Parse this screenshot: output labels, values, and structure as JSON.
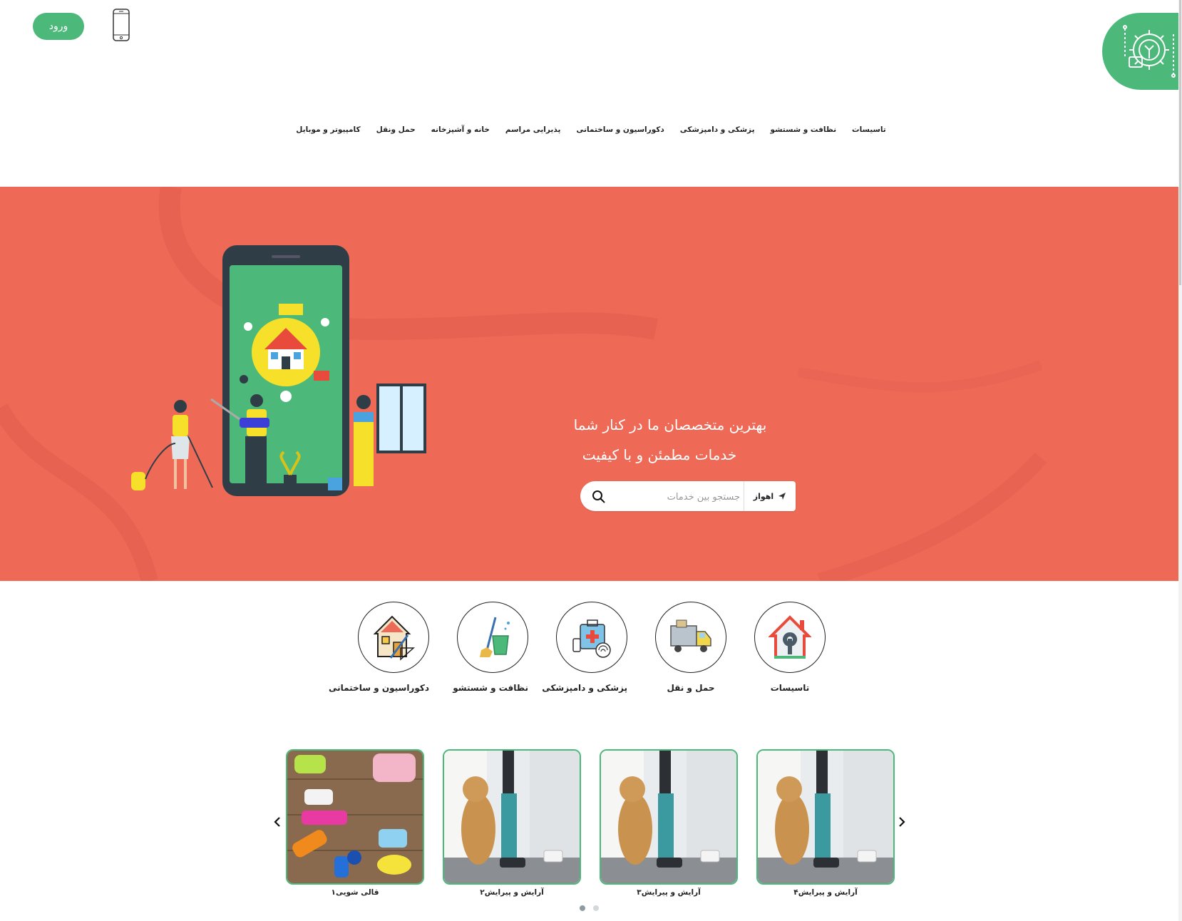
{
  "header": {
    "login_label": "ورود",
    "phone_icon": "mobile-phone-icon",
    "logo_icon": "gear-wrench-logo-icon",
    "brand_color": "#4cb97a"
  },
  "nav": {
    "items": [
      {
        "label": "تاسیسات"
      },
      {
        "label": "نظافت و شستشو"
      },
      {
        "label": "پزشکی و دامپزشکی"
      },
      {
        "label": "دکوراسیون و ساختمانی"
      },
      {
        "label": "پذیرایی مراسم"
      },
      {
        "label": "خانه و آشپزخانه"
      },
      {
        "label": "حمل ونقل"
      },
      {
        "label": "کامپیوتر و موبایل"
      }
    ]
  },
  "hero": {
    "background_color": "#ee6a57",
    "headline": "بهترین متخصصان ما در کنار شما",
    "subheadline": "خدمات مطمئن و با کیفیت",
    "city_label": "اهواز",
    "search_placeholder": "جستجو بین خدمات"
  },
  "categories": [
    {
      "label": "تاسیسات",
      "icon": "house-wrench-icon"
    },
    {
      "label": "حمل و نقل",
      "icon": "delivery-truck-icon"
    },
    {
      "label": "پزشکی و دامپزشکی",
      "icon": "medical-kit-icon"
    },
    {
      "label": "نظافت و شستشو",
      "icon": "mop-bucket-icon"
    },
    {
      "label": "دکوراسیون و ساختمانی",
      "icon": "house-tools-icon"
    }
  ],
  "carousel": {
    "items": [
      {
        "label": "آرایش و پیرایش۴",
        "image": "dog-vacuum-photo"
      },
      {
        "label": "آرایش و پیرایش۳",
        "image": "dog-vacuum-photo"
      },
      {
        "label": "آرایش و پیرایش۲",
        "image": "dog-vacuum-photo"
      },
      {
        "label": "قالی شویی۱",
        "image": "cleaning-supplies-photo"
      }
    ],
    "prev_icon": "chevron-left-icon",
    "next_icon": "chevron-right-icon",
    "active_dot": 1,
    "dot_count": 2
  }
}
